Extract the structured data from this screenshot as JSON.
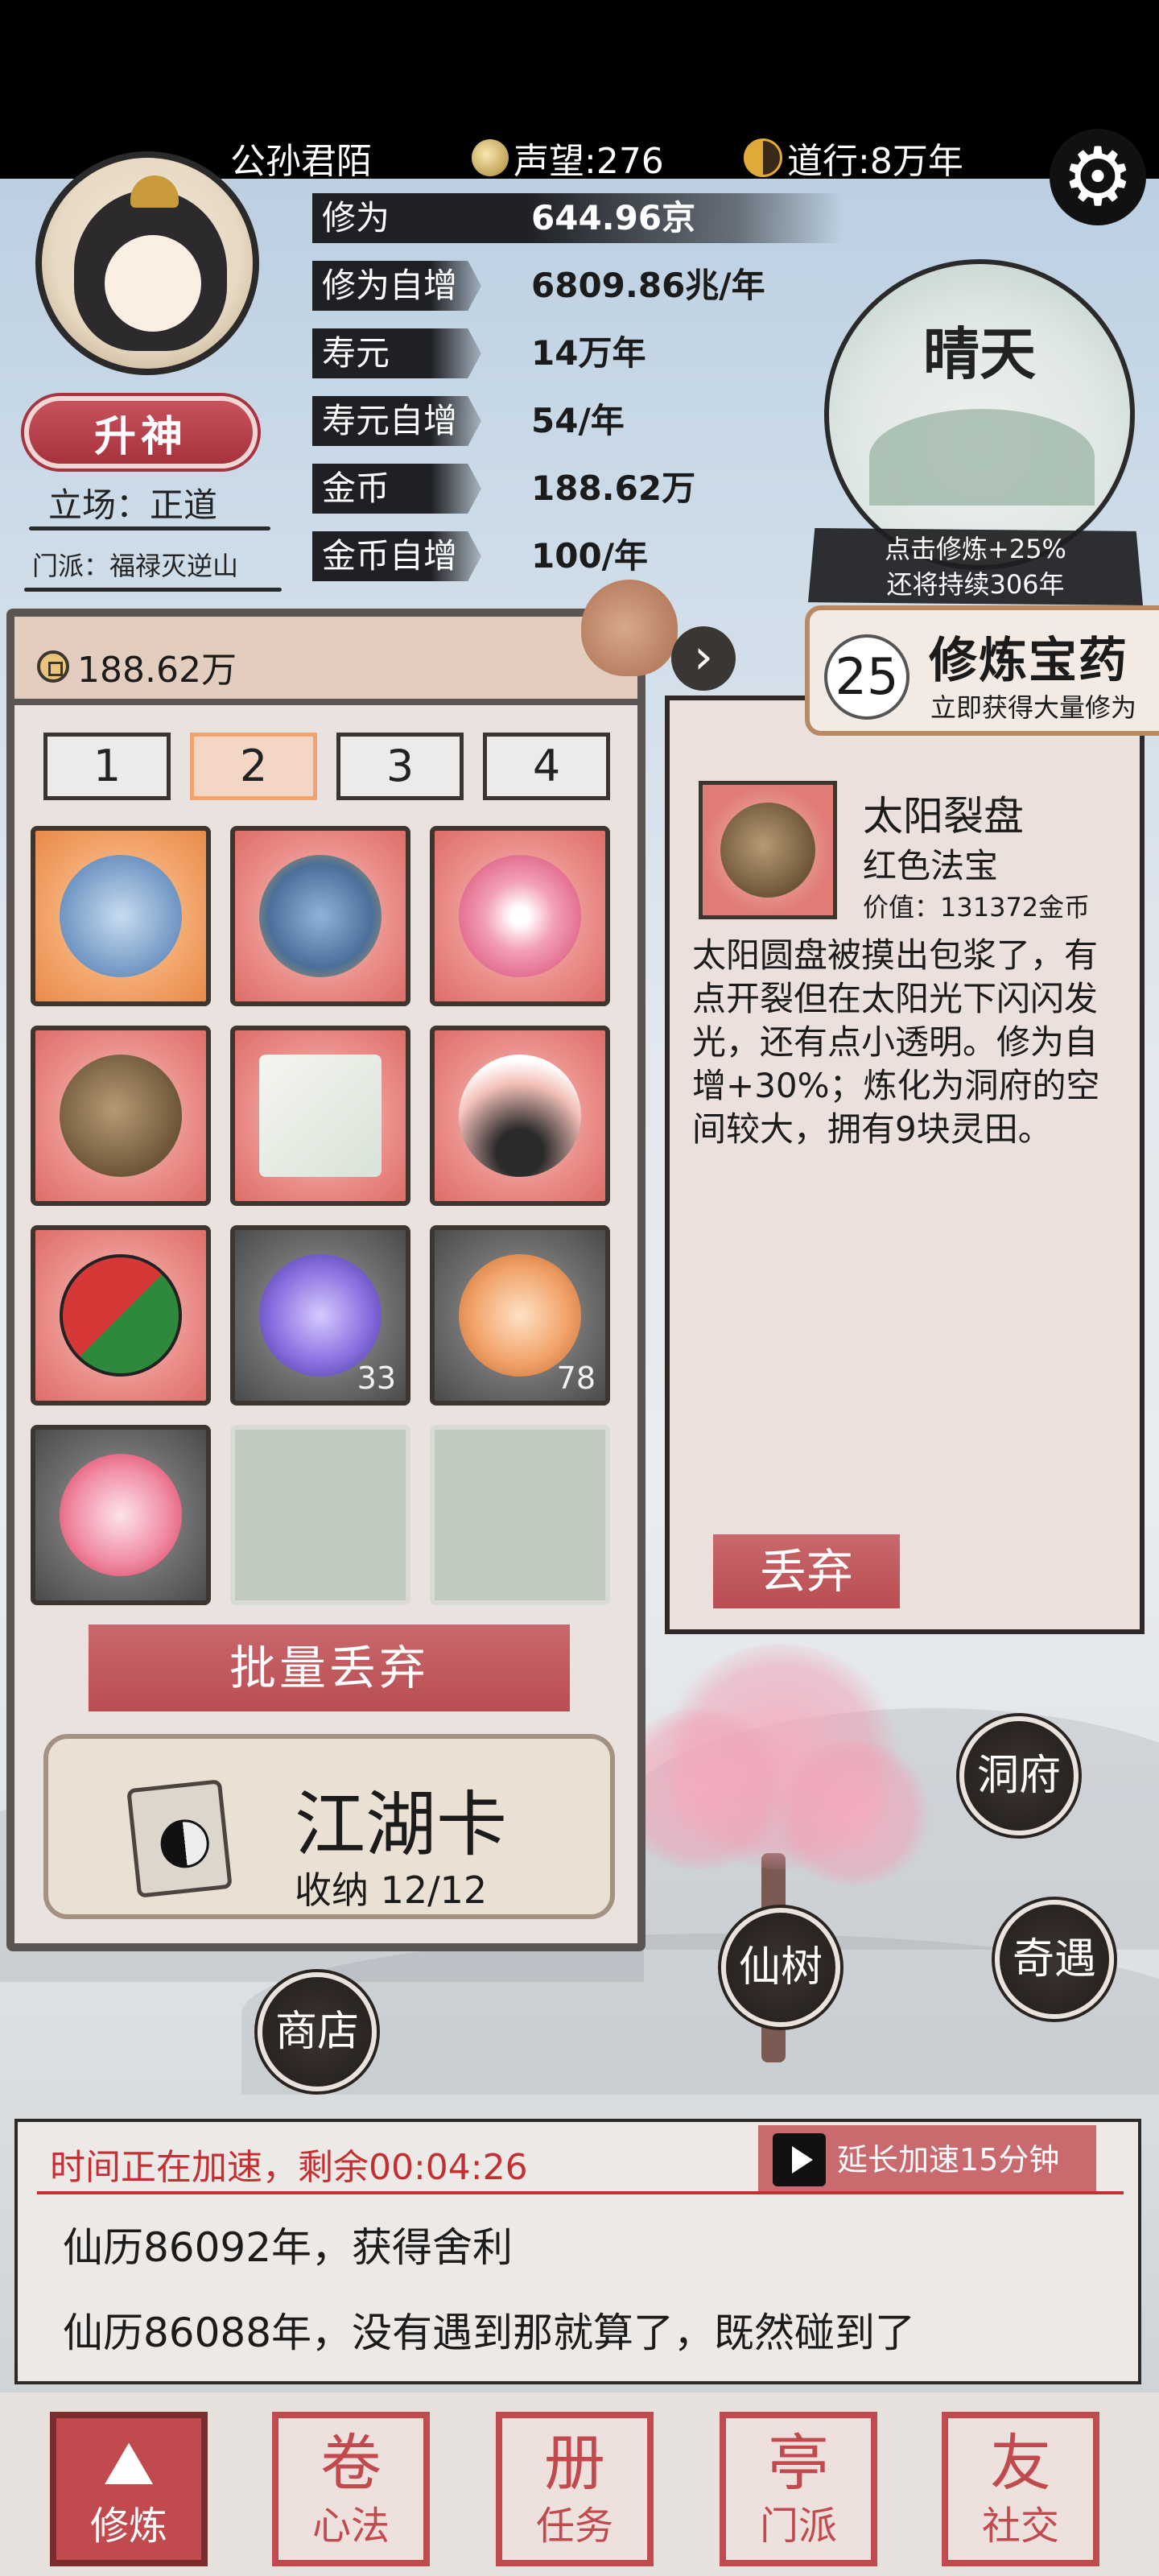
{
  "header": {
    "player_name": "公孙君陌",
    "reputation": "声望:276",
    "dao": "道行:8万年"
  },
  "profile": {
    "ascend_label": "升神",
    "stance": "立场：正道",
    "sect": "门派：福禄灭逆山"
  },
  "stats": [
    {
      "label": "修为",
      "value": "644.96京"
    },
    {
      "label": "修为自增",
      "value": "6809.86兆/年"
    },
    {
      "label": "寿元",
      "value": "14万年"
    },
    {
      "label": "寿元自增",
      "value": "54/年"
    },
    {
      "label": "金币",
      "value": "188.62万"
    },
    {
      "label": "金币自增",
      "value": "100/年"
    }
  ],
  "weather": {
    "label": "晴天",
    "note_line1": "点击修炼+25%",
    "note_line2": "还将持续306年"
  },
  "medicine": {
    "count": "25",
    "title": "修炼宝药",
    "subtitle": "立即获得大量修为"
  },
  "bag": {
    "gold": "188.62万",
    "tabs": [
      "1",
      "2",
      "3",
      "4"
    ],
    "active_tab": "2",
    "items": [
      {
        "name": "blue-robe",
        "rarity": "orange",
        "count": ""
      },
      {
        "name": "helmet",
        "rarity": "red",
        "count": ""
      },
      {
        "name": "lotus",
        "rarity": "red",
        "count": ""
      },
      {
        "name": "sun-disc",
        "rarity": "red",
        "count": ""
      },
      {
        "name": "scroll-book",
        "rarity": "red",
        "count": ""
      },
      {
        "name": "spirit-grass",
        "rarity": "red",
        "count": ""
      },
      {
        "name": "red-green-orb",
        "rarity": "red",
        "count": ""
      },
      {
        "name": "purple-vortex",
        "rarity": "gray",
        "count": "33"
      },
      {
        "name": "orange-vortex",
        "rarity": "gray",
        "count": "78"
      },
      {
        "name": "red-vortex",
        "rarity": "gray",
        "count": ""
      },
      {
        "name": "empty",
        "rarity": "empty",
        "count": ""
      },
      {
        "name": "empty",
        "rarity": "empty",
        "count": ""
      }
    ],
    "batch_discard_label": "批量丢弃",
    "card_title": "江湖卡",
    "card_sub": "收纳 12/12"
  },
  "detail": {
    "name": "太阳裂盘",
    "grade": "红色法宝",
    "price": "价值：131372金币",
    "description": "太阳圆盘被摸出包浆了，有点开裂但在太阳光下闪闪发光，还有点小透明。修为自增+30%；炼化为洞府的空间较大，拥有9块灵田。",
    "discard_label": "丢弃"
  },
  "actions": {
    "cave": "洞府",
    "tree": "仙树",
    "adventure": "奇遇",
    "shop": "商店"
  },
  "log": {
    "speed_text": "时间正在加速，剩余00:04:26",
    "extend_label": "延长加速15分钟",
    "lines": [
      "仙历86092年，获得舍利",
      "仙历86088年，没有遇到那就算了，既然碰到了"
    ]
  },
  "nav": [
    {
      "label": "修炼",
      "glyph": "⛰"
    },
    {
      "label": "心法",
      "glyph": "卷"
    },
    {
      "label": "任务",
      "glyph": "册"
    },
    {
      "label": "门派",
      "glyph": "亭"
    },
    {
      "label": "社交",
      "glyph": "友"
    }
  ],
  "colors": {
    "accent_red": "#c04a4d",
    "speed_red": "#c23034",
    "panel_bg": "#e9e2de"
  }
}
